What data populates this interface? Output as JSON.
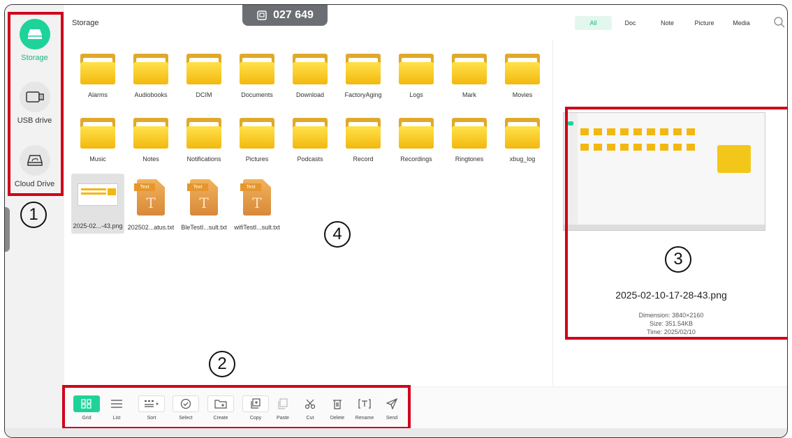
{
  "header": {
    "title": "Storage",
    "code": "027 649",
    "filters": [
      "All",
      "Doc",
      "Note",
      "Picture",
      "Media"
    ],
    "active_filter": "All"
  },
  "sidebar": {
    "items": [
      {
        "label": "Storage",
        "icon": "storage-icon",
        "active": true
      },
      {
        "label": "USB drive",
        "icon": "usb-drive-icon",
        "active": false
      },
      {
        "label": "Cloud Drive",
        "icon": "cloud-drive-icon",
        "active": false
      }
    ]
  },
  "folders_row1": [
    "Alarms",
    "Audiobooks",
    "DCIM",
    "Documents",
    "Download",
    "FactoryAging",
    "Logs",
    "Mark",
    "Movies"
  ],
  "folders_row2": [
    "Music",
    "Notes",
    "Notifications",
    "Pictures",
    "Podcasts",
    "Record",
    "Recordings",
    "Ringtones",
    "xbug_log"
  ],
  "files": [
    {
      "name": "2025-02...-43.png",
      "type": "image"
    },
    {
      "name": "202502...atus.txt",
      "type": "text",
      "badge": "Text",
      "glyph": "T"
    },
    {
      "name": "BleTestI...sult.txt",
      "type": "text",
      "badge": "Text",
      "glyph": "T"
    },
    {
      "name": "wifiTestI...sult.txt",
      "type": "text",
      "badge": "Text",
      "glyph": "T"
    }
  ],
  "preview": {
    "file_name": "2025-02-10-17-28-43.png",
    "dimension": "Dimension: 3840×2160",
    "size": "Size: 351.54KB",
    "time": "Time: 2025/02/10"
  },
  "toolbar": {
    "items": [
      "Grid",
      "List",
      "Sort",
      "Select",
      "Create",
      "Copy",
      "Paste",
      "Cut",
      "Delete",
      "Rename",
      "Send"
    ],
    "active": "Grid"
  },
  "callouts": [
    "1",
    "2",
    "3",
    "4"
  ],
  "colors": {
    "accent": "#1ed39a",
    "annotation_red": "#d0021b",
    "folder_yellow": "#f3b80f"
  }
}
